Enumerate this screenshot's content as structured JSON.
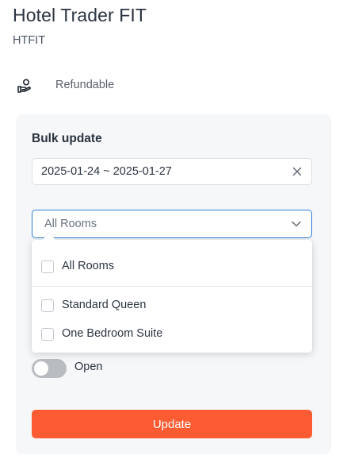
{
  "header": {
    "title": "Hotel Trader FIT",
    "code": "HTFIT"
  },
  "policy": {
    "icon": "hand-coin-icon",
    "label": "Refundable"
  },
  "bulk_update": {
    "title": "Bulk update",
    "date_range": "2025-01-24 ~ 2025-01-27",
    "room_select": {
      "value": "All Rooms",
      "options": [
        {
          "label": "All Rooms",
          "checked": false
        },
        {
          "label": "Standard Queen",
          "checked": false
        },
        {
          "label": "One Bedroom Suite",
          "checked": false
        }
      ]
    },
    "status_toggle": {
      "label": "Open",
      "on": false
    },
    "submit_label": "Update"
  },
  "colors": {
    "accent": "#fd5c33",
    "focus_border": "#2b7fd6",
    "panel_bg": "#f6f7f9"
  }
}
